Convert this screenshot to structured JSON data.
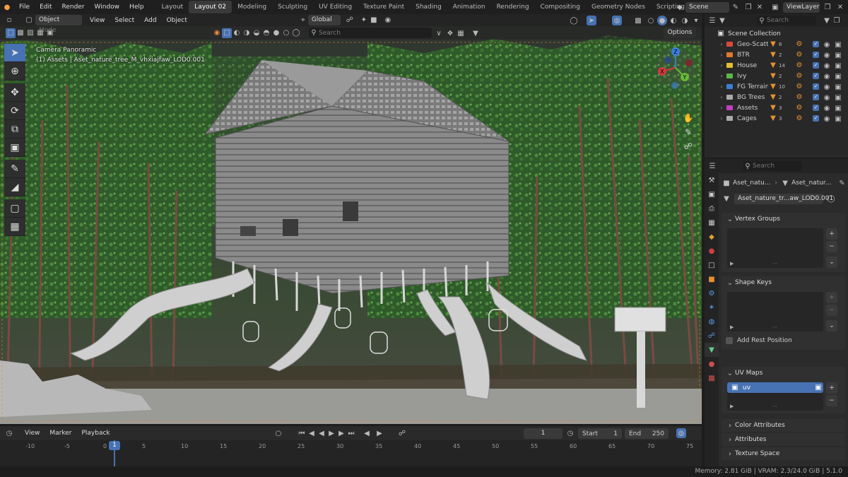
{
  "menus": [
    "File",
    "Edit",
    "Render",
    "Window",
    "Help"
  ],
  "workspaces": [
    {
      "label": "Layout",
      "active": false
    },
    {
      "label": "Layout 02",
      "active": true
    },
    {
      "label": "Modeling",
      "active": false
    },
    {
      "label": "Sculpting",
      "active": false
    },
    {
      "label": "UV Editing",
      "active": false
    },
    {
      "label": "Texture Paint",
      "active": false
    },
    {
      "label": "Shading",
      "active": false
    },
    {
      "label": "Animation",
      "active": false
    },
    {
      "label": "Rendering",
      "active": false
    },
    {
      "label": "Compositing",
      "active": false
    },
    {
      "label": "Geometry Nodes",
      "active": false
    },
    {
      "label": "Scripting",
      "active": false
    }
  ],
  "add_workspace": "+",
  "scene_name": "Scene",
  "view_layer": "ViewLayer",
  "viewport": {
    "mode": "Object Mode",
    "menus": [
      "View",
      "Select",
      "Add",
      "Object"
    ],
    "transform_orientation": "Global",
    "search_placeholder": "Search",
    "options_label": "Options",
    "camera_label": "Camera Panoramic",
    "active_object": "(1) Assets | Aset_nature_tree_M_vhxiajfaw_LOD0.001"
  },
  "gizmo": {
    "x": "X",
    "y": "Y",
    "z": "Z"
  },
  "outliner": {
    "search_placeholder": "Search",
    "root": "Scene Collection",
    "collections": [
      {
        "name": "Geo-Scatter",
        "color": "#d84a3a",
        "count": "6"
      },
      {
        "name": "BTR",
        "color": "#e07830",
        "count": "2"
      },
      {
        "name": "House",
        "color": "#e0c030",
        "count": "14"
      },
      {
        "name": "Ivy",
        "color": "#5cb848",
        "count": "2"
      },
      {
        "name": "FG Terrain",
        "color": "#3a80d8",
        "count": "10"
      },
      {
        "name": "BG Trees",
        "color": "#aaaaaa",
        "count": "2"
      },
      {
        "name": "Assets",
        "color": "#c040c0",
        "count": "3"
      },
      {
        "name": "Cages",
        "color": "#aaaaaa",
        "count": "3"
      }
    ]
  },
  "properties": {
    "search_placeholder": "Search",
    "breadcrumb_object": "Aset_natu...",
    "breadcrumb_mesh": "Aset_natur...",
    "mesh_name": "Aset_nature_tr...aw_LOD0.001",
    "panels": {
      "vertex_groups": "Vertex Groups",
      "shape_keys": "Shape Keys",
      "add_rest_position": "Add Rest Position",
      "uv_maps": "UV Maps",
      "uv_name": "uv",
      "color_attributes": "Color Attributes",
      "attributes": "Attributes",
      "texture_space": "Texture Space"
    }
  },
  "timeline": {
    "menus": [
      "View",
      "Marker",
      "Playback"
    ],
    "current_frame": "1",
    "start_label": "Start",
    "start": "1",
    "end_label": "End",
    "end": "250",
    "ticks": [
      "-10",
      "-5",
      "0",
      "5",
      "10",
      "15",
      "20",
      "25",
      "30",
      "35",
      "40",
      "45",
      "50",
      "55",
      "60",
      "65",
      "70",
      "75"
    ],
    "playhead": "1"
  },
  "status": "Memory: 2.81 GiB | VRAM: 2.3/24.0 GiB | 5.1.0",
  "colors": {
    "accent": "#4772b3",
    "background": "#1d1d1d",
    "panel": "#303030"
  }
}
